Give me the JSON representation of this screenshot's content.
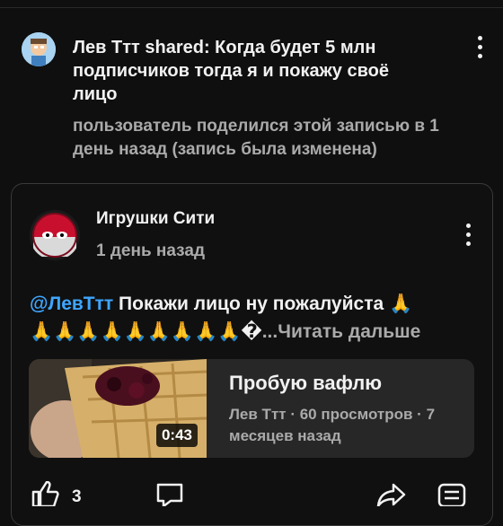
{
  "shared_post": {
    "title": "Лев Ттт shared: Когда будет 5 млн подписчиков тогда я и покажу своё лицо",
    "meta": "пользователь поделился этой записью в 1 день назад (запись была изменена)"
  },
  "community_post": {
    "author": "Игрушки Сити",
    "time": "1 день назад",
    "mention": "@ЛевТтт",
    "text_line1": " Покажи лицо ну пожалуйста ",
    "pray_emoji": "🙏",
    "pray_row": "🙏🙏🙏🙏🙏🙏🙏🙏🙏",
    "broken_glyph": "�",
    "read_more": "...Читать дальше"
  },
  "video": {
    "title": "Пробую вафлю",
    "meta": "Лев Ттт · 60 просмотров · 7 месяцев назад",
    "duration": "0:43"
  },
  "actions": {
    "like_count": "3"
  },
  "icons": [
    "more-vert-icon",
    "thumb-up-icon",
    "comment-icon",
    "share-icon",
    "save-icon"
  ]
}
